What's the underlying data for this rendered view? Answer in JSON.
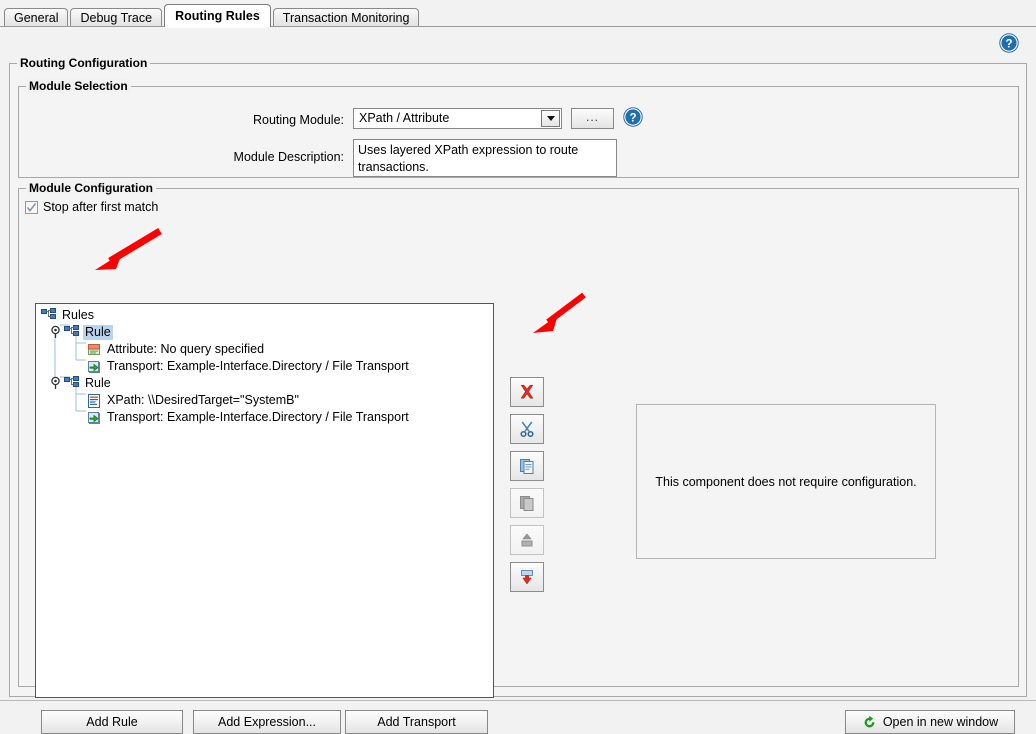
{
  "window": {
    "tabs": [
      {
        "label": "General",
        "active": false
      },
      {
        "label": "Debug Trace",
        "active": false
      },
      {
        "label": "Routing Rules",
        "active": true
      },
      {
        "label": "Transaction Monitoring",
        "active": false
      }
    ],
    "help_icon": "help-circle-icon"
  },
  "routing_configuration": {
    "legend": "Routing Configuration",
    "module_selection": {
      "legend": "Module Selection",
      "routing_module_label": "Routing Module:",
      "routing_module_value": "XPath / Attribute",
      "routing_module_options": [
        "XPath / Attribute"
      ],
      "browse_button_label": "...",
      "help_icon": "help-circle-icon",
      "module_description_label": "Module Description:",
      "module_description_value": "Uses layered XPath expression to route transactions."
    },
    "module_configuration": {
      "legend": "Module Configuration",
      "stop_after_first_match_label": "Stop after first match",
      "stop_after_first_match_checked": true,
      "tree": {
        "root_label": "Rules",
        "root_icon": "rules-node-icon",
        "nodes": [
          {
            "label": "Rule",
            "icon": "rule-node-icon",
            "selected": true,
            "expanded": true,
            "children": [
              {
                "label": "Attribute: No query specified",
                "icon": "attribute-icon"
              },
              {
                "label": "Transport: Example-Interface.Directory / File Transport",
                "icon": "transport-icon"
              }
            ]
          },
          {
            "label": "Rule",
            "icon": "rule-node-icon",
            "selected": false,
            "expanded": true,
            "children": [
              {
                "label": "XPath: \\\\DesiredTarget=\"SystemB\"",
                "icon": "xpath-icon"
              },
              {
                "label": "Transport: Example-Interface.Directory / File Transport",
                "icon": "transport-icon"
              }
            ]
          }
        ]
      },
      "toolbar": [
        {
          "name": "delete-button",
          "icon": "red-x-icon",
          "enabled": true
        },
        {
          "name": "cut-button",
          "icon": "scissors-icon",
          "enabled": true
        },
        {
          "name": "copy-button",
          "icon": "copy-icon",
          "enabled": true
        },
        {
          "name": "paste-button",
          "icon": "paste-icon",
          "enabled": false
        },
        {
          "name": "move-up-button",
          "icon": "arrow-up-icon",
          "enabled": false
        },
        {
          "name": "move-down-button",
          "icon": "arrow-down-icon",
          "enabled": true
        }
      ],
      "config_panel_message": "This component does not require configuration.",
      "buttons": {
        "add_rule": "Add Rule",
        "add_expression": "Add Expression...",
        "add_transport": "Add Transport",
        "open_in_new_window": "Open in new window",
        "open_in_new_window_icon": "green-refresh-icon"
      }
    }
  },
  "annotations": [
    {
      "name": "arrow-pointing-to-rule-node",
      "color": "#ff0000"
    },
    {
      "name": "arrow-pointing-to-delete-button",
      "color": "#ff0000"
    }
  ],
  "colors": {
    "accent_blue": "#1f6fb0",
    "selection_blue": "#b8d4ef",
    "annotation_red": "#ff0000",
    "green": "#00a000",
    "window_bg": "#f2f2f2"
  }
}
